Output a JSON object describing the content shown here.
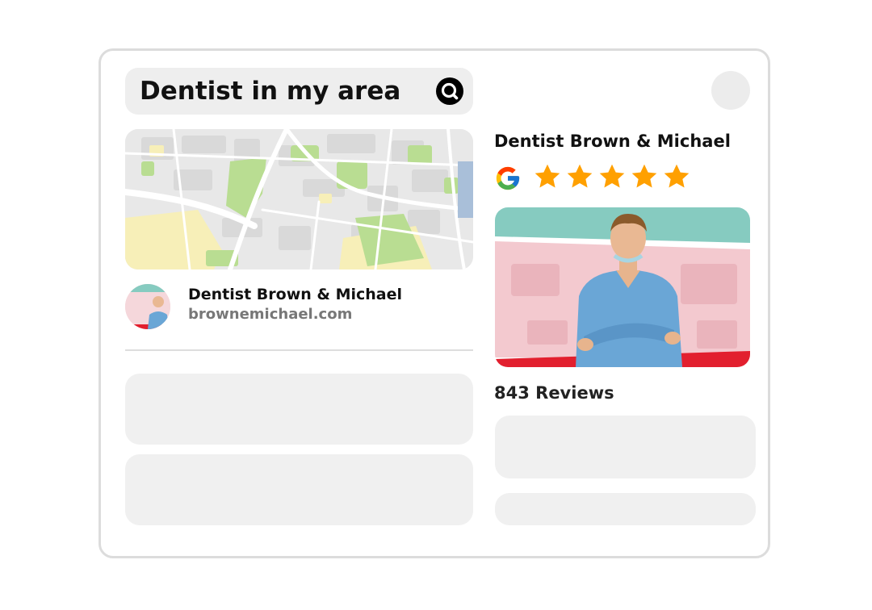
{
  "search": {
    "query": "Dentist in my area",
    "button_icon": "search-icon"
  },
  "profile_icon": "avatar-placeholder",
  "listing": {
    "name": "Dentist Brown & Michael",
    "url": "brownemichael.com"
  },
  "business_card": {
    "name": "Dentist Brown & Michael",
    "rating_source_icon": "google-icon",
    "rating_stars": 5,
    "reviews_label": "843 Reviews"
  },
  "colors": {
    "star": "#ffa000",
    "teal_band": "#86cbc0",
    "red_band": "#e21f2e",
    "placeholder": "#f0f0f0"
  }
}
